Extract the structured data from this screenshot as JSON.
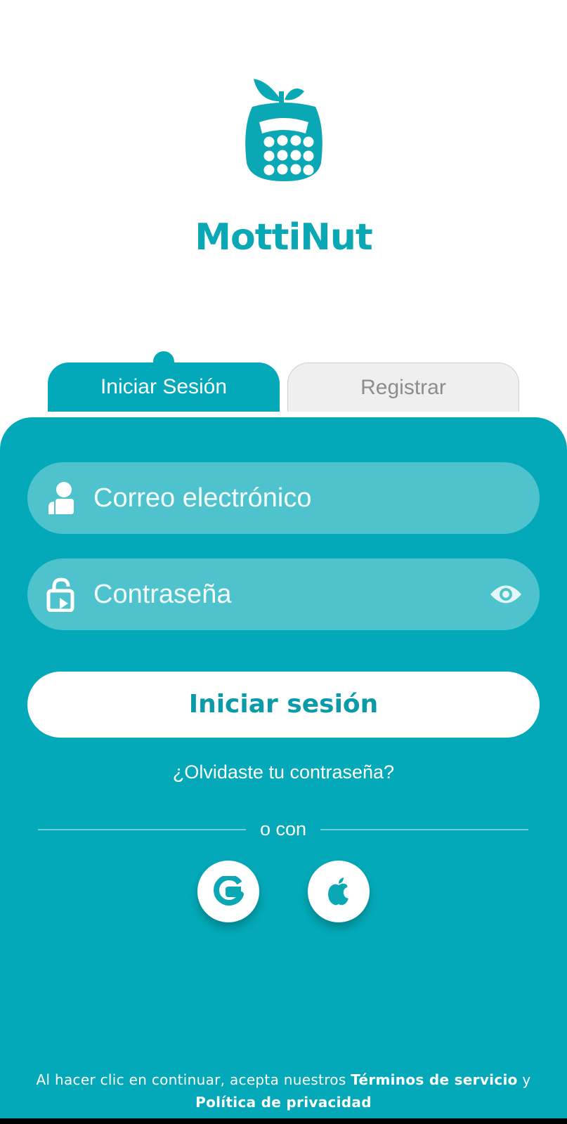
{
  "app": {
    "name": "MottiNut"
  },
  "tabs": [
    {
      "label": "Iniciar Sesión",
      "active": true
    },
    {
      "label": "Registrar",
      "active": false
    }
  ],
  "form": {
    "email_placeholder": "Correo electrónico",
    "password_placeholder": "Contraseña",
    "login_label": "Iniciar sesión",
    "forgot_label": "¿Olvidaste tu contraseña?",
    "divider_label": "o con"
  },
  "social": {
    "google_label": "G"
  },
  "legal": {
    "prefix": "Al hacer clic en continuar, acepta nuestros ",
    "terms": "Términos de servicio",
    "joiner": " y ",
    "privacy": "Política de privacidad"
  },
  "icons": [
    "apple-fruit-logo-icon",
    "user-icon",
    "lock-icon",
    "eye-icon",
    "google-icon",
    "apple-icon"
  ],
  "colors": {
    "accent": "#03a9b8",
    "field": "#4fc3cd",
    "inactive_tab": "#efefef"
  }
}
